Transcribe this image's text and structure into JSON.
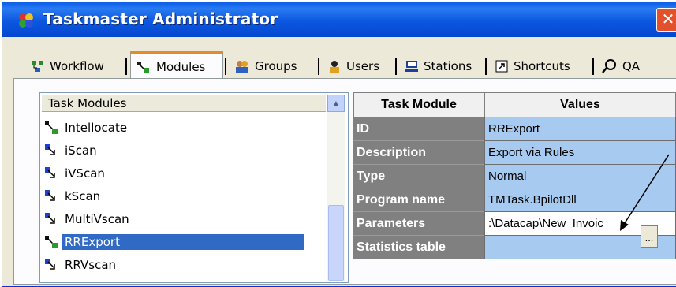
{
  "window": {
    "title": "Taskmaster Administrator"
  },
  "tabs": [
    {
      "label": "Workflow",
      "icon": "workflow-icon"
    },
    {
      "label": "Modules",
      "icon": "modules-icon",
      "active": true
    },
    {
      "label": "Groups",
      "icon": "groups-icon"
    },
    {
      "label": "Users",
      "icon": "user-icon"
    },
    {
      "label": "Stations",
      "icon": "computer-icon"
    },
    {
      "label": "Shortcuts",
      "icon": "shortcut-icon"
    },
    {
      "label": "QA",
      "icon": "magnifier-icon"
    }
  ],
  "modules_list": {
    "header": "Task Modules",
    "items": [
      {
        "label": "Intellocate"
      },
      {
        "label": "iScan"
      },
      {
        "label": "iVScan"
      },
      {
        "label": "kScan"
      },
      {
        "label": "MultiVscan"
      },
      {
        "label": "RRExport",
        "selected": true
      },
      {
        "label": "RRVscan"
      }
    ]
  },
  "properties_grid": {
    "headers": {
      "key": "Task Module",
      "value": "Values"
    },
    "rows": [
      {
        "key": "ID",
        "value": "RRExport"
      },
      {
        "key": "Description",
        "value": "Export via Rules"
      },
      {
        "key": "Type",
        "value": "Normal"
      },
      {
        "key": "Program name",
        "value": "TMTask.BpilotDll"
      },
      {
        "key": "Parameters",
        "value": ":\\Datacap\\New_Invoic"
      },
      {
        "key": "Statistics table",
        "value": ""
      }
    ],
    "ellipsis_label": "..."
  },
  "colors": {
    "titlebar": "#0b57df",
    "selection": "#316ac5",
    "grid_key_bg": "#808080",
    "grid_value_bg": "#a6caf0",
    "close_button": "#e2512b"
  }
}
